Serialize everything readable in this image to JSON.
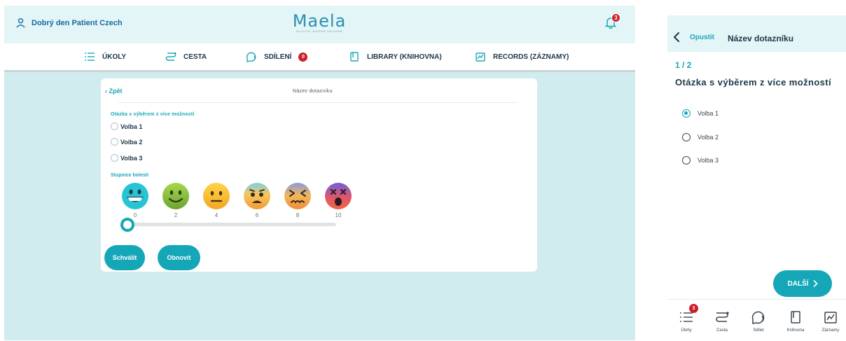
{
  "desktop": {
    "greeting": "Dobrý den Patient Czech",
    "logo": {
      "word": "Maela",
      "tagline": "SA ALTRI INSIEME SALENNE"
    },
    "notifications_count": "3",
    "nav": [
      {
        "label": "ÚKOLY",
        "icon": "list-icon"
      },
      {
        "label": "CESTA",
        "icon": "route-icon"
      },
      {
        "label": "SDÍLENÍ",
        "icon": "chat-icon",
        "badge": "0"
      },
      {
        "label": "LIBRARY (KNIHOVNA)",
        "icon": "book-icon"
      },
      {
        "label": "RECORDS (ZÁZNAMY)",
        "icon": "chart-icon"
      }
    ],
    "questionnaire": {
      "back_label": "Zpět",
      "title": "Název dotazníku",
      "question_label": "Otázka s výběrem z více možností",
      "options": [
        "Volba 1",
        "Volba 2",
        "Volba 3"
      ],
      "scale_label": "Stupnice bolesti",
      "scale_ticks": [
        "0",
        "2",
        "4",
        "6",
        "8",
        "10"
      ],
      "scale_value": 0,
      "approve_label": "Schválit",
      "reset_label": "Obnovit"
    }
  },
  "mobile": {
    "back_label": "Opustit",
    "title": "Název dotazníku",
    "step": "1 / 2",
    "question": "Otázka s výběrem z více možností",
    "options": [
      "Volba 1",
      "Volba 2",
      "Volba 3"
    ],
    "selected_option": "Volba 1",
    "next_label": "DALŠÍ",
    "tabs": [
      {
        "label": "Úlohy",
        "icon": "list-icon",
        "badge": "3"
      },
      {
        "label": "Cesta",
        "icon": "route-icon"
      },
      {
        "label": "Sdílet",
        "icon": "chat-icon"
      },
      {
        "label": "Knihovna",
        "icon": "book-icon"
      },
      {
        "label": "Záznamy",
        "icon": "chart-icon"
      }
    ]
  },
  "colors": {
    "accent": "#15a7b8",
    "badge": "#cc1f2a",
    "background": "#d1ecee",
    "header": "#e3f5f6",
    "text": "#1d3748"
  }
}
